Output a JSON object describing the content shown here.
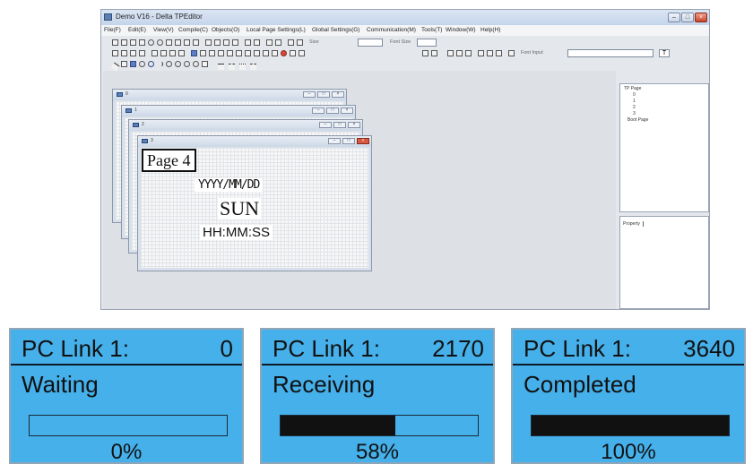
{
  "editor": {
    "title": "Demo V16 - Delta TPEditor",
    "menus": [
      "File(F)",
      "Edit(E)",
      "View(V)",
      "Compile(C)",
      "Objects(O)",
      "Local Page Settings(L)",
      "Global Settings(G)",
      "Communication(M)",
      "Tools(T)",
      "Window(W)",
      "Help(H)"
    ],
    "toolbar": {
      "size_label": "Size",
      "font_size_label": "Font Size",
      "font_input_placeholder": "Font Input",
      "text_button": "T"
    },
    "pages": [
      {
        "name": "0"
      },
      {
        "name": "1"
      },
      {
        "name": "2"
      },
      {
        "name": "3"
      }
    ],
    "active_page_content": {
      "title": "Page 4",
      "date": "YYYY/MM/DD",
      "day": "SUN",
      "time": "HH:MM:SS"
    },
    "tree": {
      "root": "TP Page",
      "children": [
        "0",
        "1",
        "2",
        "3"
      ],
      "boot": "Boot Page"
    },
    "property_tab": "Property"
  },
  "lcd_panels": [
    {
      "label": "PC Link 1:",
      "count": "0",
      "status": "Waiting",
      "progress": 0,
      "percent_text": "0%"
    },
    {
      "label": "PC Link 1:",
      "count": "2170",
      "status": "Receiving",
      "progress": 0.58,
      "percent_text": "58%"
    },
    {
      "label": "PC Link 1:",
      "count": "3640",
      "status": "Completed",
      "progress": 1.0,
      "percent_text": "100%"
    }
  ],
  "colors": {
    "lcd_background": "#45b0ea",
    "lcd_bar_fill": "#111111"
  }
}
